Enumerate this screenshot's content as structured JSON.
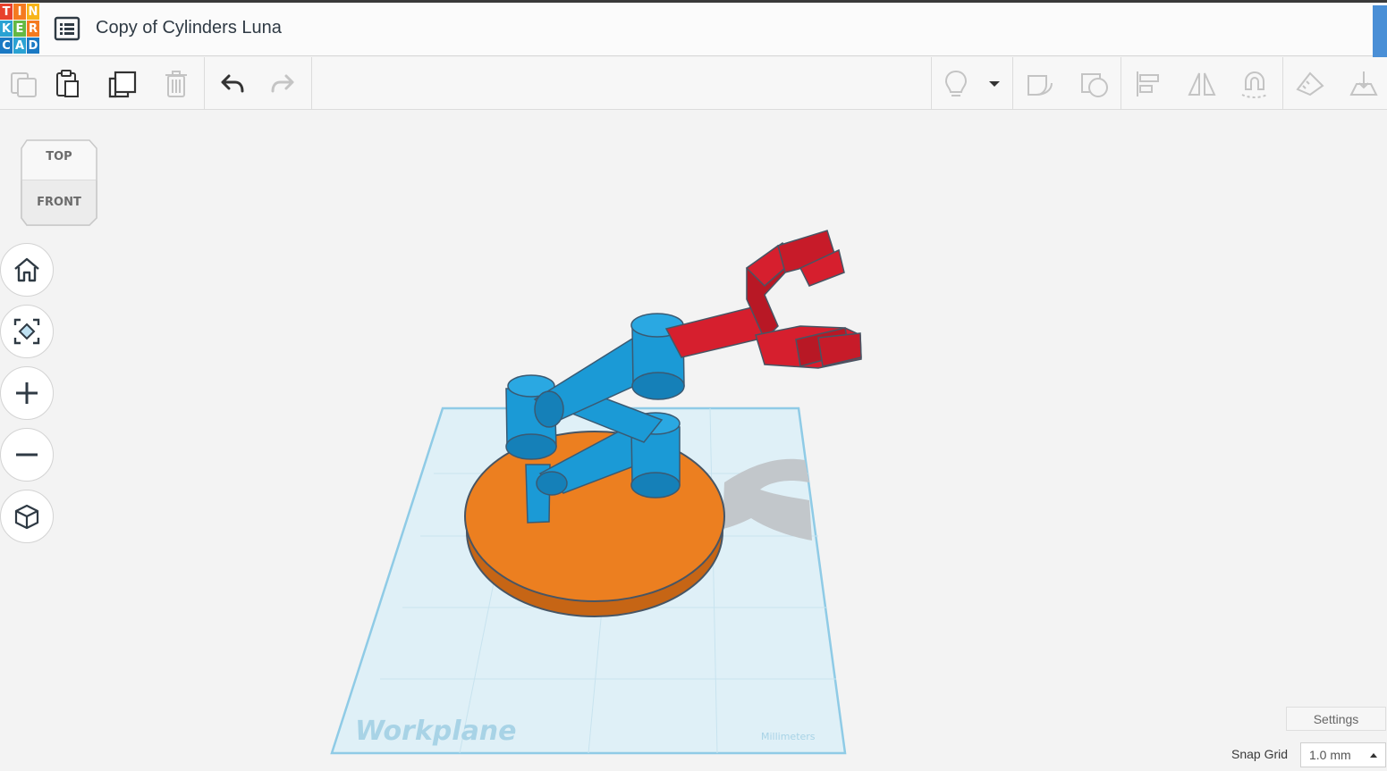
{
  "app": {
    "logo_letters": [
      "T",
      "I",
      "N",
      "K",
      "E",
      "R",
      "C",
      "A",
      "D"
    ],
    "logo_colors": [
      "#e8412c",
      "#f47a20",
      "#f7b519",
      "#2aa2d3",
      "#64b843",
      "#f47a20",
      "#1a79c4",
      "#2aa2d3",
      "#1a79c4"
    ],
    "document_title": "Copy of Cylinders Luna"
  },
  "viewcube": {
    "top_label": "TOP",
    "front_label": "FRONT"
  },
  "workplane": {
    "label": "Workplane",
    "units": "Millimeters"
  },
  "bottom_bar": {
    "settings_label": "Settings",
    "snap_label": "Snap Grid",
    "snap_value": "1.0 mm"
  },
  "colors": {
    "accent": "#4a8fd6",
    "base_orange": "#ec7f20",
    "arm_blue": "#1b9ad6",
    "claw_red": "#d61f2e",
    "workplane_fill": "#dff0f7",
    "workplane_edge": "#8fcbe6"
  }
}
